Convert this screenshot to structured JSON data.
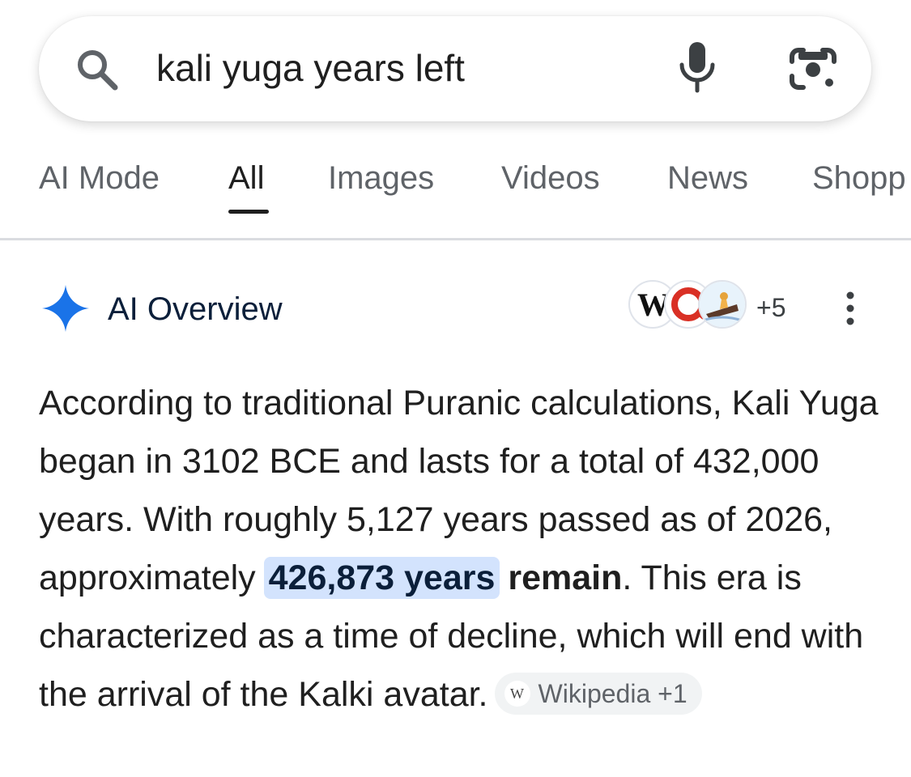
{
  "search": {
    "query": "kali yuga years left",
    "icons": {
      "search": "search-icon",
      "voice": "mic-icon",
      "lens": "google-lens-icon"
    }
  },
  "tabs": [
    {
      "label": "AI Mode",
      "active": false
    },
    {
      "label": "All",
      "active": true
    },
    {
      "label": "Images",
      "active": false
    },
    {
      "label": "Videos",
      "active": false
    },
    {
      "label": "News",
      "active": false
    },
    {
      "label": "Shopp",
      "active": false
    }
  ],
  "ai_overview": {
    "title": "AI Overview",
    "favicon_labels": [
      "W"
    ],
    "source_more": "+5",
    "text_before": "According to traditional Puranic calculations, Kali Yuga began in 3102 BCE and lasts for a total of 432,000 years. With roughly 5,127 years passed as of 2026, approximately ",
    "highlight": "426,873 years",
    "bold_after": " remain",
    "text_after": ". This era is characterized as a time of decline, which will end with the arrival of the Kalki avatar.",
    "source_chip": {
      "icon_letter": "W",
      "label": "Wikipedia +1"
    }
  },
  "colors": {
    "accent_highlight": "#d3e3fd",
    "spark": "#1a73e8",
    "text": "#1f1f1f",
    "muted": "#5f6368"
  }
}
